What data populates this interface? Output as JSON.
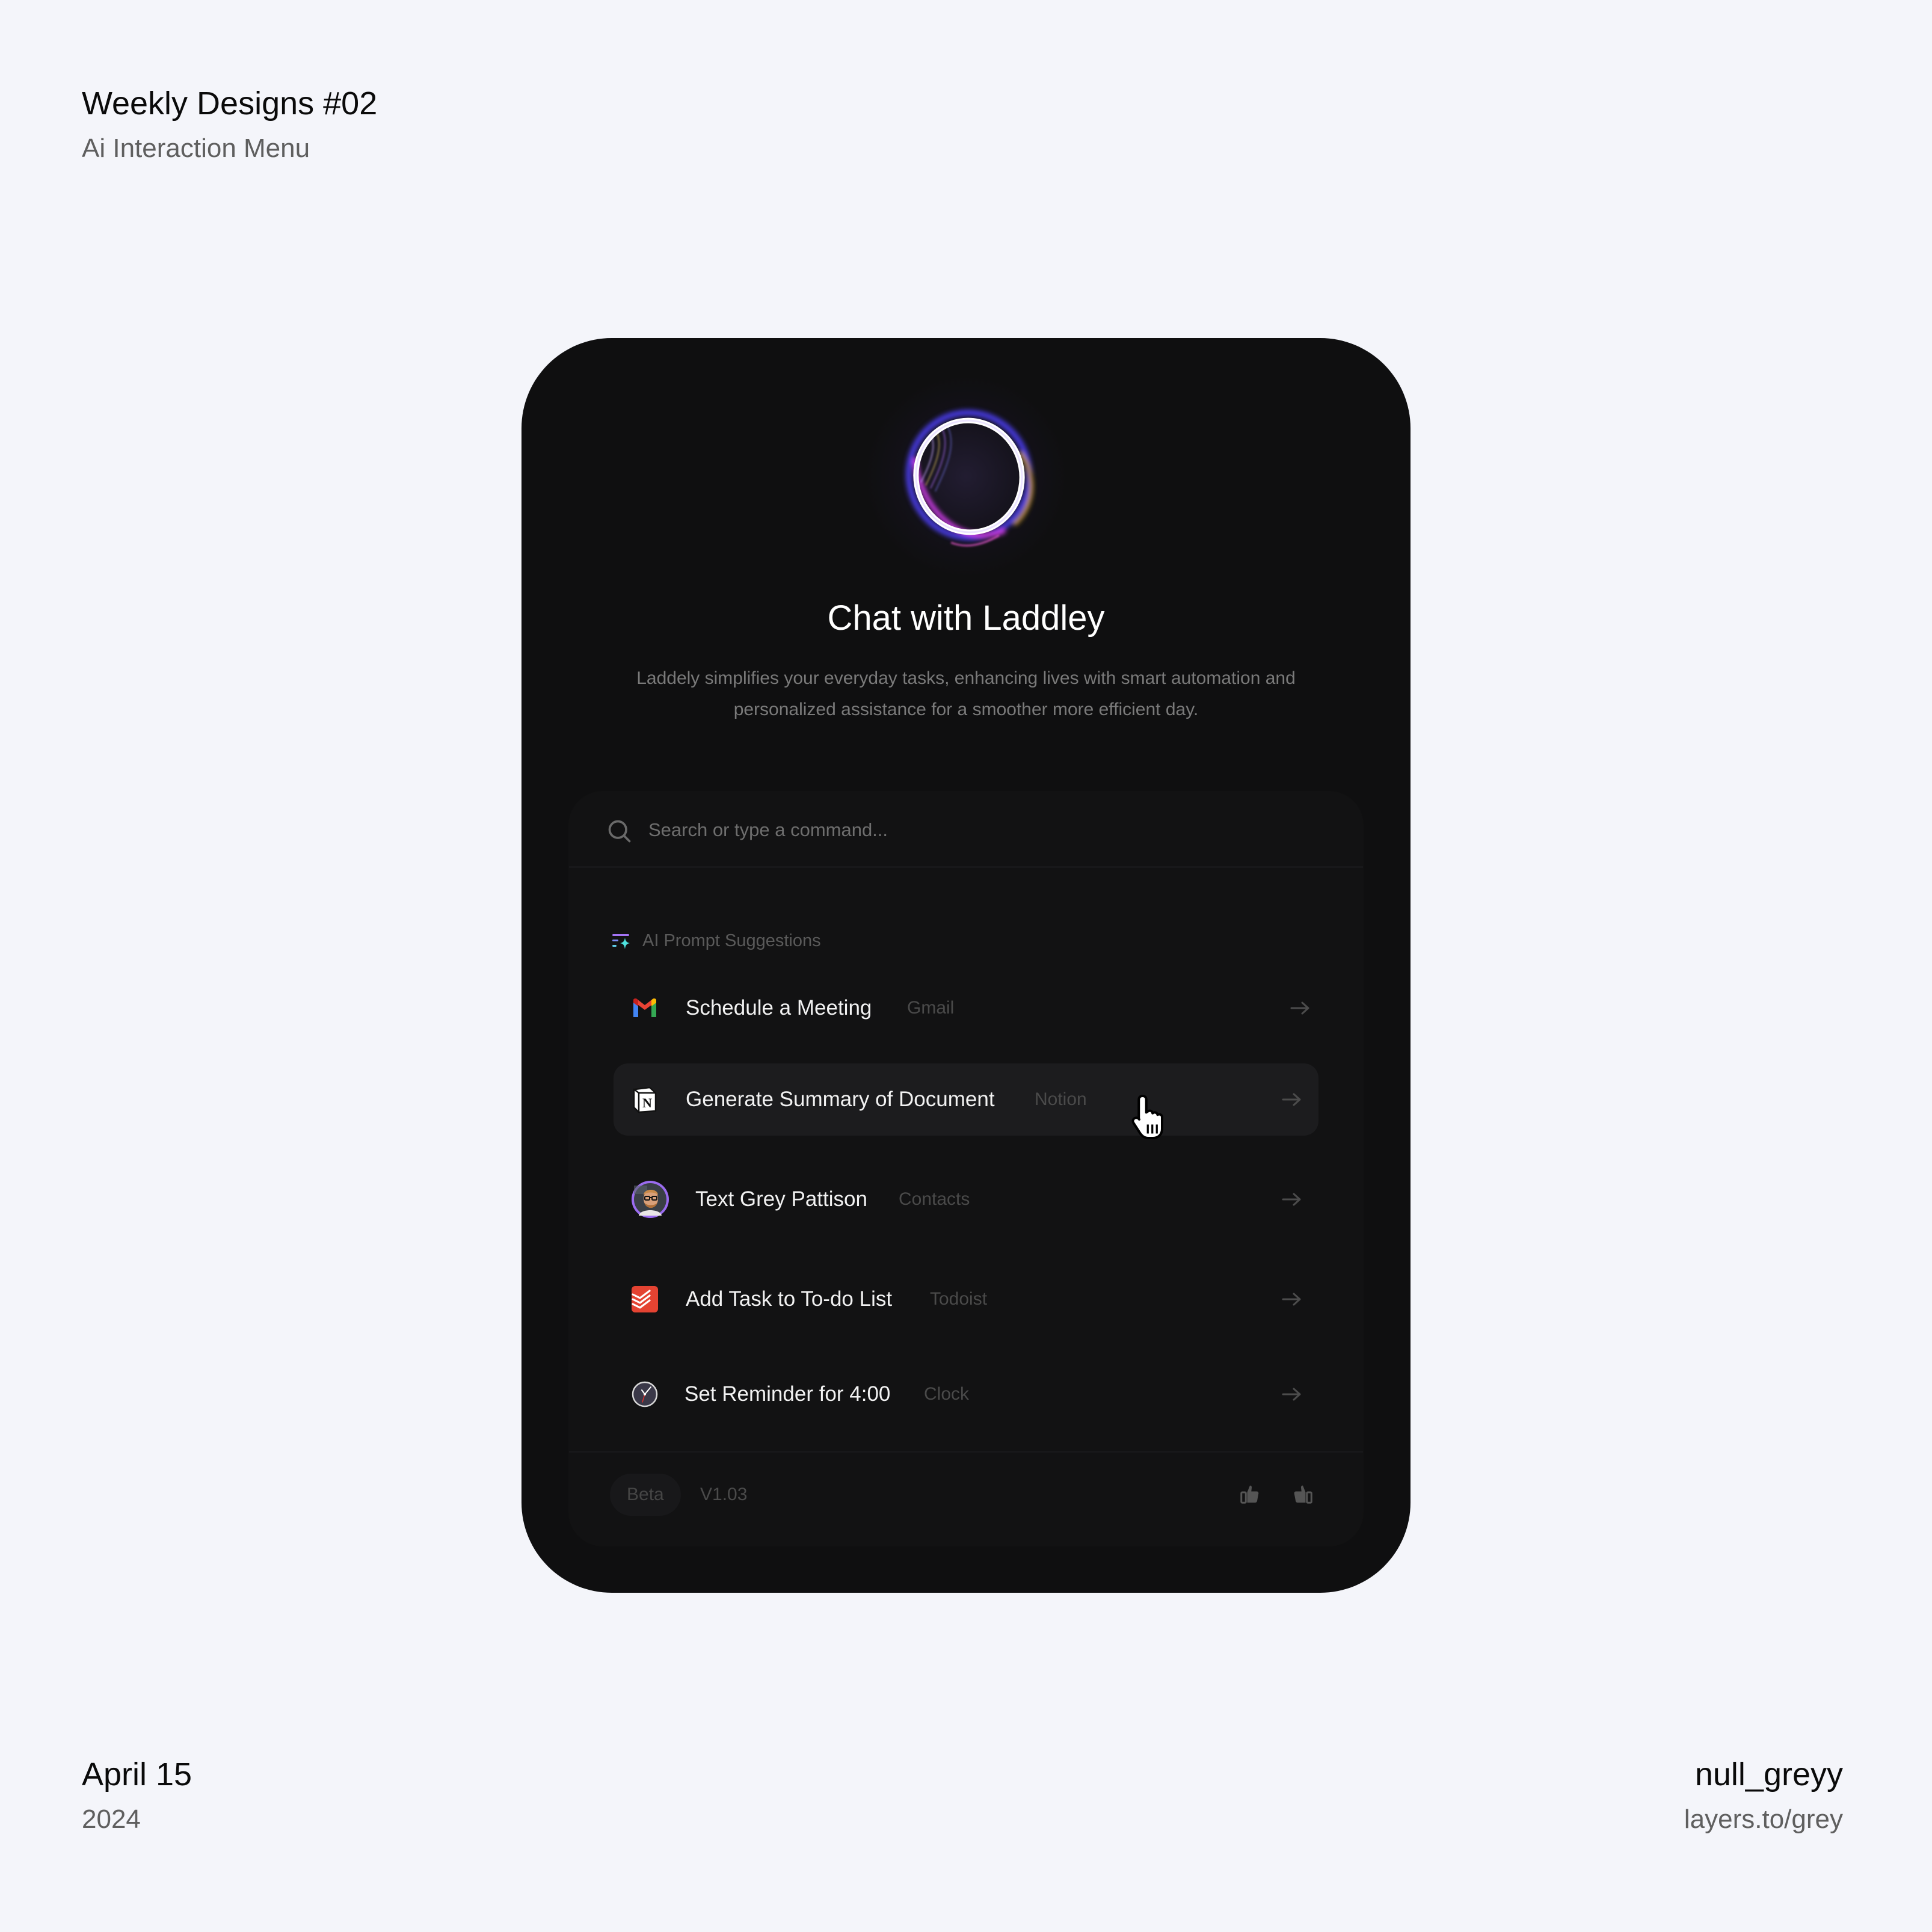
{
  "header": {
    "title": "Weekly Designs #02",
    "subtitle": "Ai Interaction Menu"
  },
  "footer_left": {
    "date": "April 15",
    "year": "2024"
  },
  "footer_right": {
    "author": "null_greyy",
    "link": "layers.to/grey"
  },
  "card": {
    "orb_icon": "ai-orb-icon",
    "title": "Chat with Laddley",
    "description": "Laddely simplifies your everyday tasks, enhancing lives with smart automation and personalized assistance for a smoother more efficient day.",
    "search": {
      "placeholder": "Search or type a command...",
      "value": "",
      "icon": "search-icon"
    },
    "suggestions": {
      "heading": "AI Prompt Suggestions",
      "heading_icon": "ai-sparkle-list-icon",
      "items": [
        {
          "title": "Schedule a Meeting",
          "app": "Gmail",
          "icon": "gmail-icon",
          "arrow": "arrow-right-icon"
        },
        {
          "title": "Generate Summary of Document",
          "app": "Notion",
          "icon": "notion-icon",
          "arrow": "arrow-right-icon",
          "hovered": true
        },
        {
          "title": "Text Grey Pattison",
          "app": "Contacts",
          "icon": "contact-avatar",
          "arrow": "arrow-right-icon"
        },
        {
          "title": "Add Task to To-do List",
          "app": "Todoist",
          "icon": "todoist-icon",
          "arrow": "arrow-right-icon"
        },
        {
          "title": "Set Reminder for 4:00",
          "app": "Clock",
          "icon": "clock-icon",
          "arrow": "arrow-right-icon"
        }
      ]
    },
    "footer": {
      "badge": "Beta",
      "version": "V1.03",
      "feedback_icons": [
        "thumbs-up-icon",
        "thumbs-up-icon"
      ]
    }
  },
  "colors": {
    "page_background": "#f4f5fa",
    "card_background": "#0f0f10",
    "panel_background": "#121213",
    "hover_row": "#1c1c1e",
    "avatar_ring": "#9b6cf0",
    "todoist_red": "#e44332",
    "sparkle_cyan": "#4fe3e0",
    "sparkle_purple": "#a374f5"
  }
}
